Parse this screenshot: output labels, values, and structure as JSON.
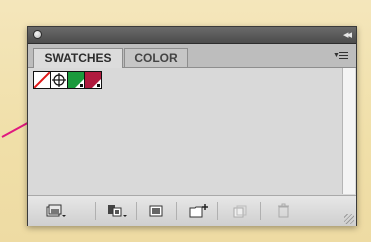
{
  "panel": {
    "tabs": [
      {
        "label": "SWATCHES",
        "active": true
      },
      {
        "label": "COLOR",
        "active": false
      }
    ],
    "collapse_glyph": "◂◂",
    "menu_icon": "panel-menu-icon"
  },
  "swatches": [
    {
      "name": "None",
      "icon": "none-swatch-icon"
    },
    {
      "name": "Registration",
      "icon": "registration-icon"
    },
    {
      "name": "Green",
      "color": "#1a9a3c"
    },
    {
      "name": "Crimson",
      "color": "#b01a3e"
    }
  ],
  "toolbar": {
    "buttons": [
      "swatch-libraries-menu-icon",
      "show-swatch-kinds-menu-icon",
      "swatch-options-icon",
      "new-color-group-icon",
      "new-swatch-icon",
      "delete-swatch-icon"
    ]
  },
  "colors": {
    "backdrop": "#f0dfa8",
    "arrow": "#e0197f",
    "panel_bg": "#d9d9d9"
  }
}
